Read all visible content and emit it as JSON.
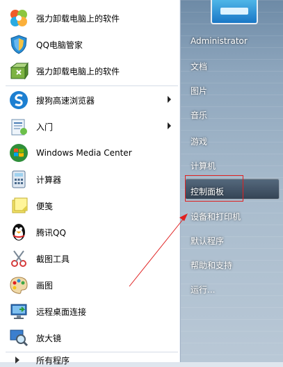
{
  "programs": [
    {
      "label": "强力卸载电脑上的软件",
      "icon": "pinwheel-icon",
      "arrow": false
    },
    {
      "label": "QQ电脑管家",
      "icon": "shield-icon",
      "arrow": false
    },
    {
      "label": "强力卸载电脑上的软件",
      "icon": "uninstall-box-icon",
      "arrow": false
    },
    {
      "label": "搜狗高速浏览器",
      "icon": "sogou-browser-icon",
      "arrow": true
    },
    {
      "label": "入门",
      "icon": "getting-started-icon",
      "arrow": true
    },
    {
      "label": "Windows Media Center",
      "icon": "windows-logo-icon",
      "arrow": false
    },
    {
      "label": "计算器",
      "icon": "calculator-icon",
      "arrow": false
    },
    {
      "label": "便笺",
      "icon": "sticky-note-icon",
      "arrow": false
    },
    {
      "label": "腾讯QQ",
      "icon": "qq-penguin-icon",
      "arrow": false
    },
    {
      "label": "截图工具",
      "icon": "scissors-icon",
      "arrow": false
    },
    {
      "label": "画图",
      "icon": "paint-palette-icon",
      "arrow": false
    },
    {
      "label": "远程桌面连接",
      "icon": "remote-desktop-icon",
      "arrow": false
    },
    {
      "label": "放大镜",
      "icon": "magnifier-icon",
      "arrow": false
    },
    {
      "label": "所有程序",
      "icon": "all-programs-arrow-icon",
      "arrow": false
    }
  ],
  "right_menu": {
    "user": "Administrator",
    "documents": "文档",
    "pictures": "图片",
    "music": "音乐",
    "games": "游戏",
    "computer": "计算机",
    "control_panel": "控制面板",
    "devices_printers": "设备和打印机",
    "default_programs": "默认程序",
    "help_support": "帮助和支持",
    "run": "运行..."
  },
  "colors": {
    "annotation": "#e02020",
    "left_bg": "#ffffff",
    "right_bg": "#8ea6bd"
  }
}
